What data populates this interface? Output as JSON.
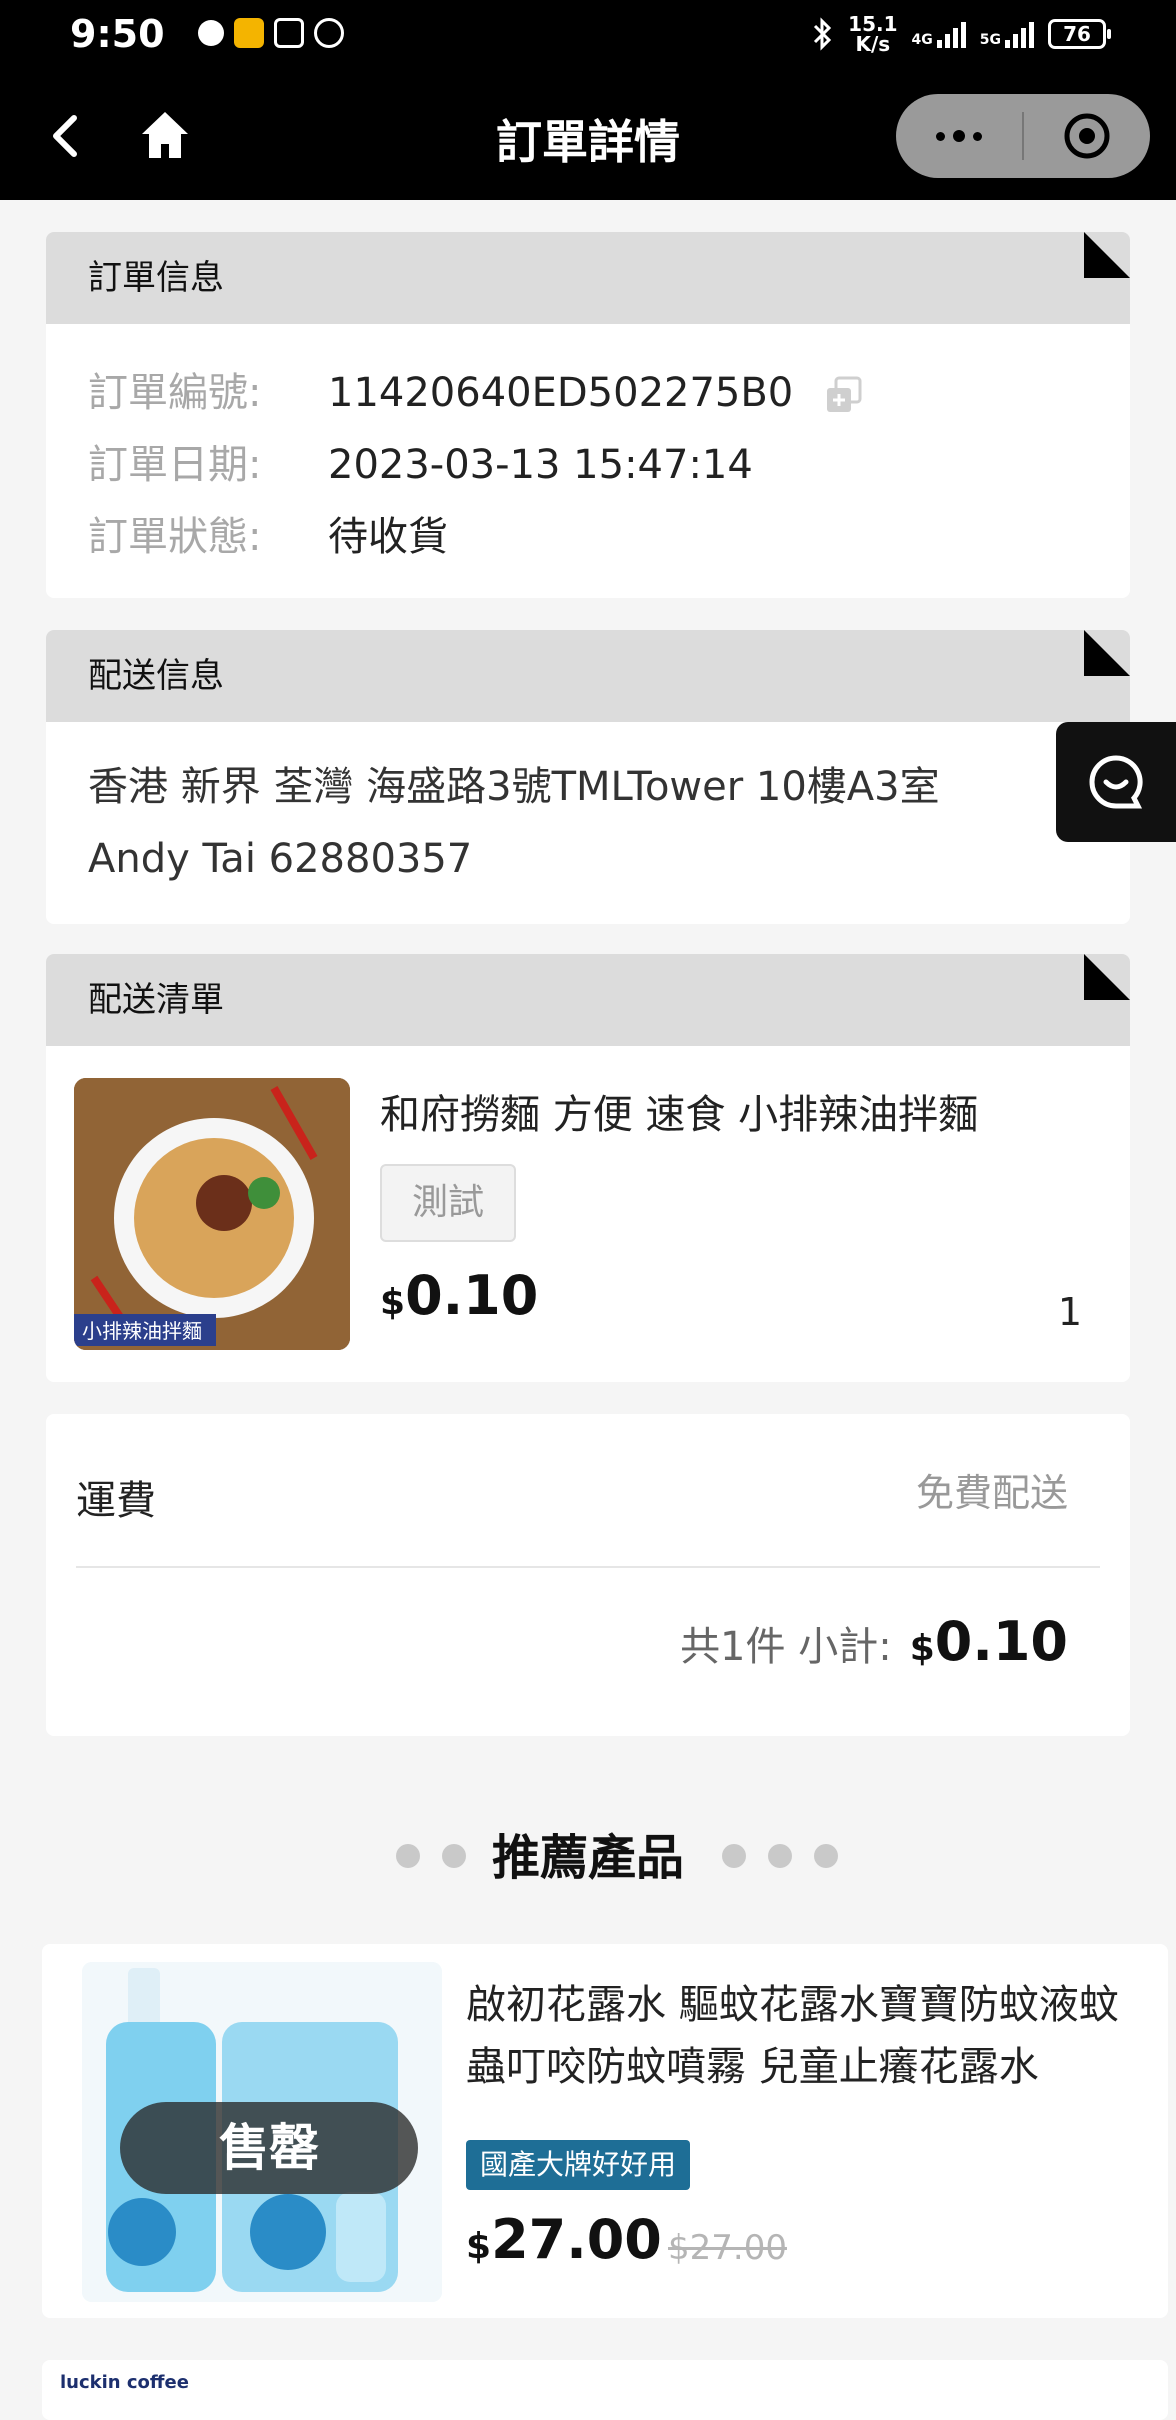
{
  "status_bar": {
    "time": "9:50",
    "net_speed_value": "15.1",
    "net_speed_unit": "K/s",
    "network_1": "4G",
    "network_2": "5G",
    "battery": "76"
  },
  "nav": {
    "title": "訂單詳情"
  },
  "order_info": {
    "header": "訂單信息",
    "rows": [
      {
        "label": "訂單編號:",
        "value": "11420640ED502275B0"
      },
      {
        "label": "訂單日期:",
        "value": "2023-03-13 15:47:14"
      },
      {
        "label": "訂單狀態:",
        "value": "待收貨"
      }
    ]
  },
  "delivery_info": {
    "header": "配送信息",
    "address": "香港 新界 荃灣 海盛路3號TMLTower 10樓A3室",
    "contact": "Andy Tai 62880357"
  },
  "delivery_list": {
    "header": "配送清單",
    "item": {
      "name": "和府撈麵 方便 速食 小排辣油拌麵",
      "thumb_caption": "小排辣油拌麵",
      "spec": "測試",
      "currency": "$",
      "price": "0.10",
      "quantity": "1"
    }
  },
  "summary": {
    "shipping_label": "運費",
    "shipping_value": "免費配送",
    "count_text": "共1件 小計:",
    "currency": "$",
    "subtotal": "0.10"
  },
  "recommend": {
    "title": "推薦產品",
    "products": [
      {
        "name": "啟初花露水 驅蚊花露水寶寶防蚊液蚊蟲叮咬防蚊噴霧 兒童止癢花露水",
        "badge": "售罄",
        "tag": "國產大牌好好用",
        "currency": "$",
        "price": "27.00",
        "original_price": "$27.00"
      }
    ],
    "next_logo": "luckin coffee"
  },
  "colors": {
    "bar": "#000000",
    "header_gray": "#dcdcdc",
    "tag_blue": "#1e6e96"
  }
}
